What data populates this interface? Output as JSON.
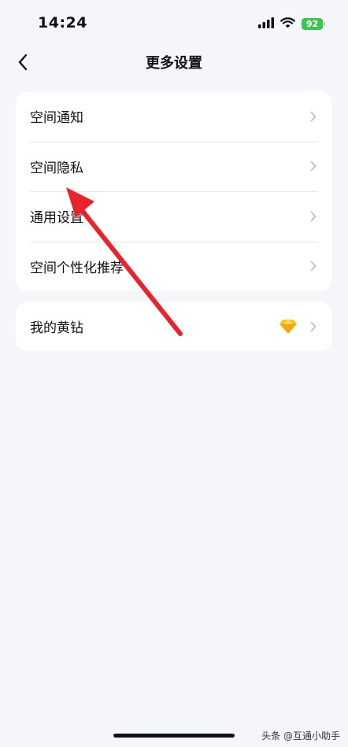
{
  "status": {
    "time": "14:24",
    "battery": "92"
  },
  "nav": {
    "title": "更多设置"
  },
  "settings": [
    {
      "label": "空间通知"
    },
    {
      "label": "空间隐私"
    },
    {
      "label": "通用设置"
    },
    {
      "label": "空间个性化推荐"
    }
  ],
  "vip": {
    "label": "我的黄钻",
    "gem_icon": "yellow-diamond-icon"
  },
  "watermark": "头条 @互通小助手",
  "colors": {
    "arrow": "#e8232a",
    "battery": "#3dc552",
    "gem": "#f7c521"
  }
}
